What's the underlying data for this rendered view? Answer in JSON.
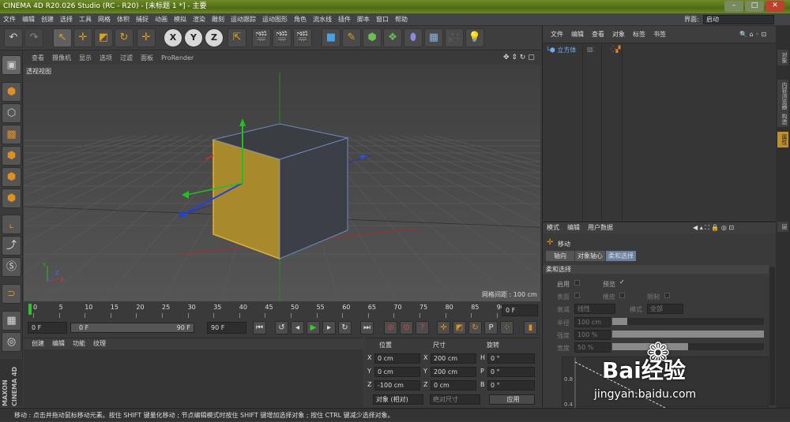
{
  "titlebar": {
    "title": "CINEMA 4D R20.026 Studio (RC - R20) - [未标题 1 *] - 主要",
    "layout_label": "界面:",
    "layout_value": "启动"
  },
  "menu": [
    "文件",
    "编辑",
    "创建",
    "选择",
    "工具",
    "网格",
    "体积",
    "捕捉",
    "动画",
    "模拟",
    "渲染",
    "雕刻",
    "运动跟踪",
    "运动图形",
    "角色",
    "流水线",
    "插件",
    "脚本",
    "窗口",
    "帮助"
  ],
  "toolbar": {
    "x": "X",
    "y": "Y",
    "z": "Z"
  },
  "viewport": {
    "tabs": [
      "查看",
      "摄像机",
      "显示",
      "选项",
      "过滤",
      "面板",
      "ProRender"
    ],
    "label": "透视视图",
    "grid_spacing": "网格间距 : 100 cm"
  },
  "timeline": {
    "ticks": [
      "0",
      "5",
      "10",
      "15",
      "20",
      "25",
      "30",
      "35",
      "40",
      "45",
      "50",
      "55",
      "60",
      "65",
      "70",
      "75",
      "80",
      "85",
      "90"
    ],
    "current_frame": "0 F"
  },
  "transport": {
    "start": "0 F",
    "range_start": "0 F",
    "range_end": "90 F",
    "end": "90 F"
  },
  "material": {
    "tabs": [
      "创建",
      "编辑",
      "功能",
      "纹理"
    ],
    "brand1": "MAXON",
    "brand2": "CINEMA 4D"
  },
  "coords": {
    "headers": [
      "位置",
      "尺寸",
      "旋转"
    ],
    "rows": [
      {
        "axis": "X",
        "pos": "0 cm",
        "size_axis": "X",
        "size": "200 cm",
        "rot_axis": "H",
        "rot": "0 °"
      },
      {
        "axis": "Y",
        "pos": "0 cm",
        "size_axis": "Y",
        "size": "200 cm",
        "rot_axis": "P",
        "rot": "0 °"
      },
      {
        "axis": "Z",
        "pos": "-100 cm",
        "size_axis": "Z",
        "size": "0 cm",
        "rot_axis": "B",
        "rot": "0 °"
      }
    ],
    "mode": "对象 (相对)",
    "size_mode": "绝对尺寸",
    "apply": "应用"
  },
  "objmgr": {
    "tabs": [
      "文件",
      "编辑",
      "查看",
      "对象",
      "标签",
      "书签"
    ],
    "object": "立方体"
  },
  "attrmgr": {
    "tabs": [
      "模式",
      "编辑",
      "用户数据"
    ],
    "tool": "移动",
    "subtabs": [
      "轴向",
      "对象轴心",
      "柔和选择"
    ],
    "section": "柔和选择",
    "enable": "启用",
    "preview": "预览",
    "surface": "表面",
    "rubber": "橡皮",
    "restrict": "限制",
    "falloff_label": "衰减",
    "falloff_value": "线性",
    "mode_label": "模式",
    "mode_value": "全部",
    "radius_label": "半径",
    "radius_value": "100 cm",
    "strength_label": "强度",
    "strength_value": "100 %",
    "width_label": "宽度",
    "width_value": "50 %",
    "graph_y1": "0.8",
    "graph_y2": "0.4"
  },
  "rightstrip": [
    "对象",
    "内容浏览器",
    "构造",
    "属性",
    "层"
  ],
  "status": "移动 : 点击并拖动鼠标移动元素。按住 SHIFT 键量化移动 ; 节点编辑模式时按住 SHIFT 键增加选择对象 ; 按住 CTRL 键减少选择对象。",
  "watermark": {
    "text": "Bai经验",
    "url": "jingyan.baidu.com"
  }
}
